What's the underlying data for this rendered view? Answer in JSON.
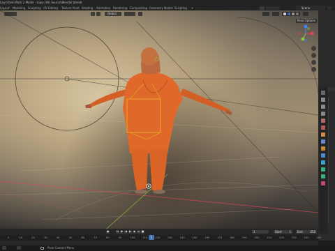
{
  "window": {
    "title": "Launched (Pack 2 Model - Copy (All) Source\\Blender.blend)",
    "scene_label": "Scene"
  },
  "workspaces": [
    "Layout",
    "Modeling",
    "Sculpting",
    "UV Editing",
    "Texture Paint",
    "Shading",
    "Animation",
    "Rendering",
    "Compositing",
    "Geometry Nodes",
    "Scripting",
    "+"
  ],
  "active_workspace": "Layout",
  "viewport": {
    "transform_orientation": "Global",
    "pose_options": "Pose Options",
    "gizmo_axes": [
      "X",
      "Y",
      "Z"
    ],
    "colors": {
      "x_axis": "#e0445b",
      "y_axis": "#8cc63f",
      "z_axis": "#3f83ff",
      "selection": "#e6b321"
    }
  },
  "timeline": {
    "frame_ticks": [
      "0",
      "10",
      "20",
      "30",
      "40",
      "50",
      "60",
      "70",
      "80",
      "90",
      "100",
      "110",
      "120",
      "130",
      "140",
      "150",
      "160",
      "170",
      "180",
      "190",
      "200",
      "210",
      "220",
      "230",
      "240",
      "250"
    ],
    "current_frame": "1",
    "start_label": "Start",
    "start_value": "1",
    "end_label": "End",
    "end_value": "250",
    "playhead": "1"
  },
  "statusbar": {
    "hint": "Pose Context Menu"
  }
}
